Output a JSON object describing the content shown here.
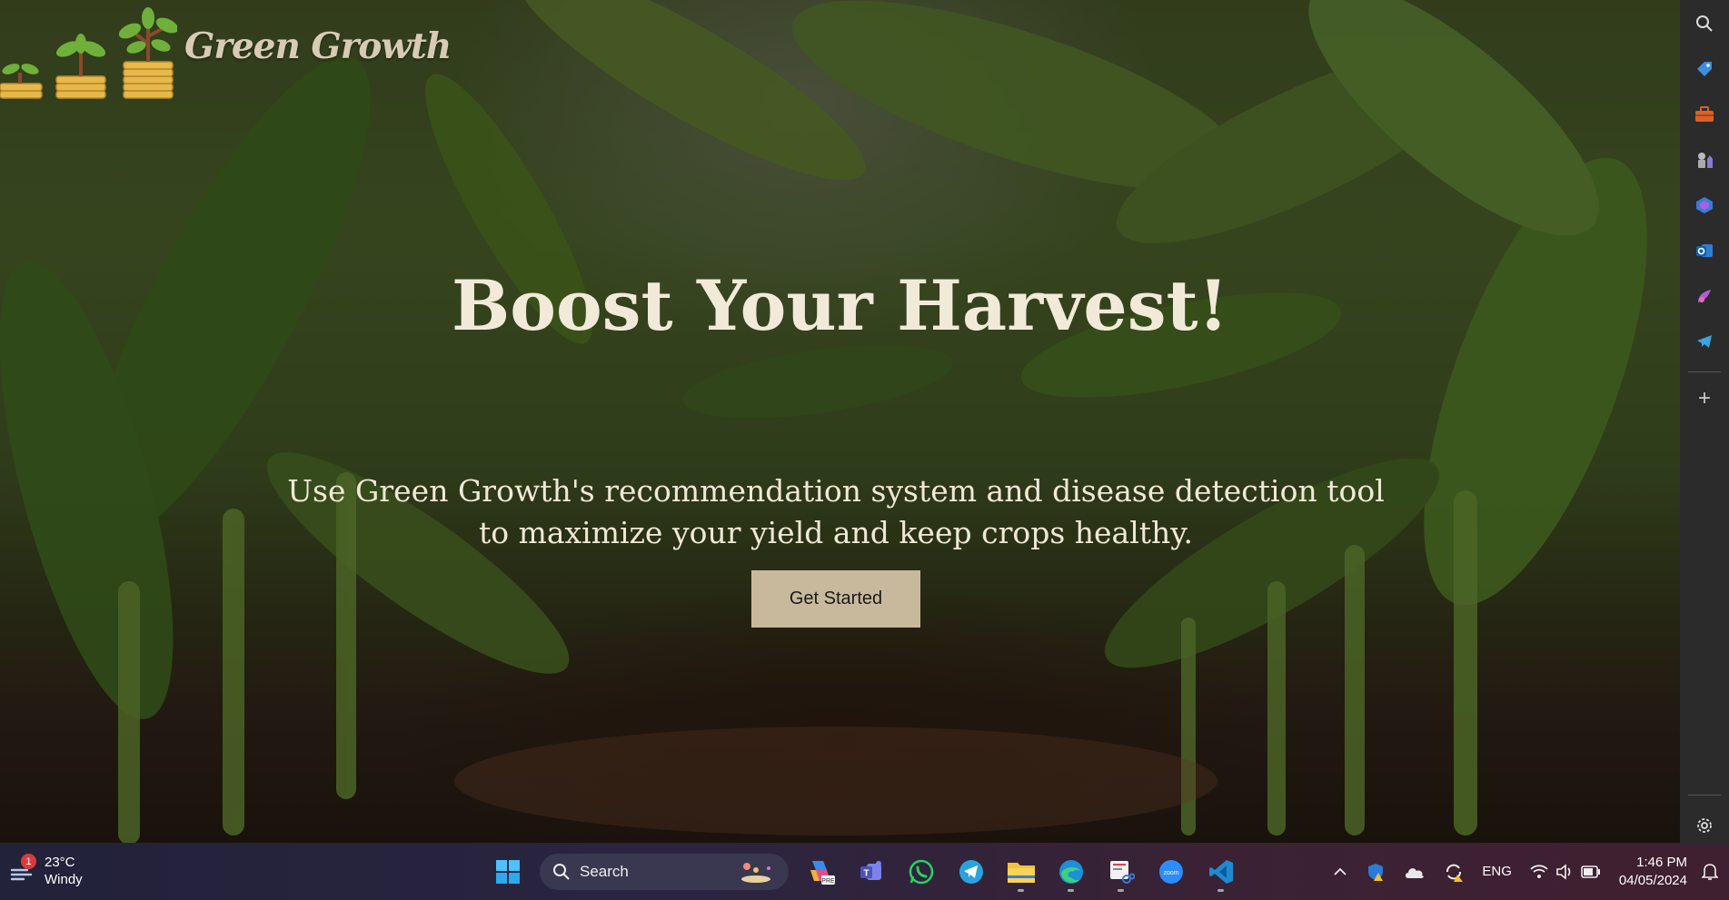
{
  "brand": {
    "name": "Green Growth"
  },
  "hero": {
    "headline": "Boost Your Harvest!",
    "subtext": "Use Green Growth's recommendation system and disease detection tool to maximize your yield and keep crops healthy.",
    "cta_label": "Get Started"
  },
  "edge_sidebar": {
    "items": [
      "search-icon",
      "tag-icon",
      "toolbox-icon",
      "chess-icon",
      "copilot-icon",
      "outlook-icon",
      "games-icon",
      "telegram-icon"
    ],
    "add_label": "+",
    "settings_icon": "gear-icon"
  },
  "taskbar": {
    "weather": {
      "temp": "23°C",
      "condition": "Windy",
      "badge": "1"
    },
    "search_placeholder": "Search",
    "apps": [
      "windows-start-icon",
      "copilot-pre-icon",
      "teams-icon",
      "whatsapp-icon",
      "telegram-icon",
      "file-explorer-icon",
      "edge-icon",
      "snipping-tool-icon",
      "zoom-icon",
      "vscode-icon"
    ],
    "tray": {
      "language": "ENG",
      "time": "1:46 PM",
      "date": "04/05/2024"
    }
  },
  "colors": {
    "cta_bg": "#c9b99c",
    "headline": "#f2ead8",
    "sidebar_bg": "#2b2b2b"
  }
}
